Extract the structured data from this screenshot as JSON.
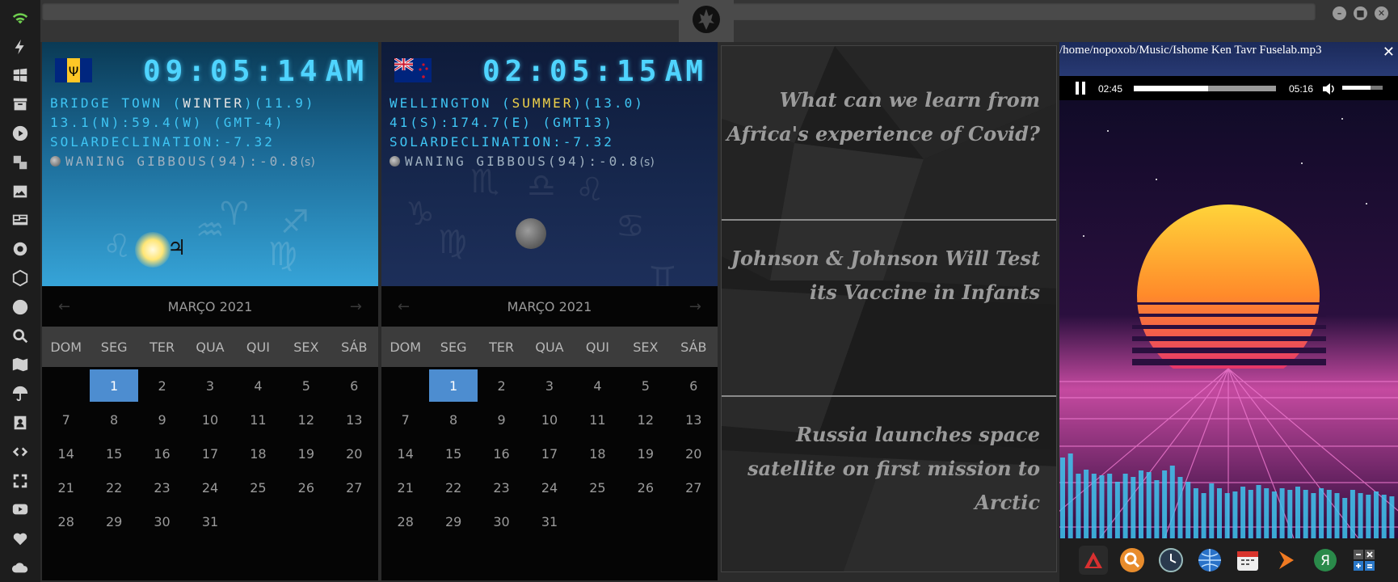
{
  "dock": {
    "icons": [
      "wifi-icon",
      "bolt-icon",
      "windows-icon",
      "archive-icon",
      "play-icon",
      "translate-icon",
      "image-icon",
      "news-icon",
      "settings-icon",
      "network-icon",
      "globe-icon",
      "search-icon",
      "map-icon",
      "umbrella-icon",
      "contact-icon",
      "code-icon",
      "expand-icon",
      "youtube-icon",
      "heart-icon",
      "cloud-icon"
    ]
  },
  "topbar": {
    "buttons": [
      "–",
      "■",
      "✕"
    ]
  },
  "clock1": {
    "time": "09:05:14",
    "ampm": "AM",
    "city": "BRIDGE TOWN",
    "season": "WINTER",
    "season_value": "(11.9)",
    "coords": "13.1(N):59.4(W) (GMT-4)",
    "solar": "SOLARDECLINATION:-7.32",
    "moon": "WANING GIBBOUS(94):-0.8",
    "moon_unit": "(s)",
    "planet_glyph": "♃"
  },
  "clock2": {
    "time": "02:05:15",
    "ampm": "AM",
    "city": "WELLINGTON",
    "season": "SUMMER",
    "season_value": "(13.0)",
    "coords": "41(S):174.7(E) (GMT13)",
    "solar": "SOLARDECLINATION:-7.32",
    "moon": "WANING GIBBOUS(94):-0.8",
    "moon_unit": "(s)"
  },
  "calendar": {
    "month_label": "MARÇO 2021",
    "prev": "←",
    "next": "→",
    "weekdays": [
      "DOM",
      "SEG",
      "TER",
      "QUA",
      "QUI",
      "SEX",
      "SÁB"
    ],
    "days": [
      "",
      "1",
      "2",
      "3",
      "4",
      "5",
      "6",
      "7",
      "8",
      "9",
      "10",
      "11",
      "12",
      "13",
      "14",
      "15",
      "16",
      "17",
      "18",
      "19",
      "20",
      "21",
      "22",
      "23",
      "24",
      "25",
      "26",
      "27",
      "28",
      "29",
      "30",
      "31",
      "",
      "",
      ""
    ],
    "today": "1"
  },
  "news": {
    "items": [
      "What can we learn from Africa's experience of Covid?",
      "Johnson & Johnson Will Test its Vaccine in Infants",
      "Russia launches space satellite on first mission to Arctic"
    ]
  },
  "player": {
    "path": "/home/nopoxob/Music/Ishome Ken Tavr Fuselab.mp3",
    "close": "✕",
    "elapsed": "02:45",
    "duration": "05:16",
    "progress_fraction": 0.52,
    "volume_fraction": 0.7
  },
  "launcher": {
    "icons": [
      "app-red-triangle-icon",
      "search-orange-icon",
      "clock-icon",
      "globe-icon",
      "calendar-icon",
      "arrow-orange-icon",
      "yandex-icon",
      "calculator-icon"
    ]
  }
}
